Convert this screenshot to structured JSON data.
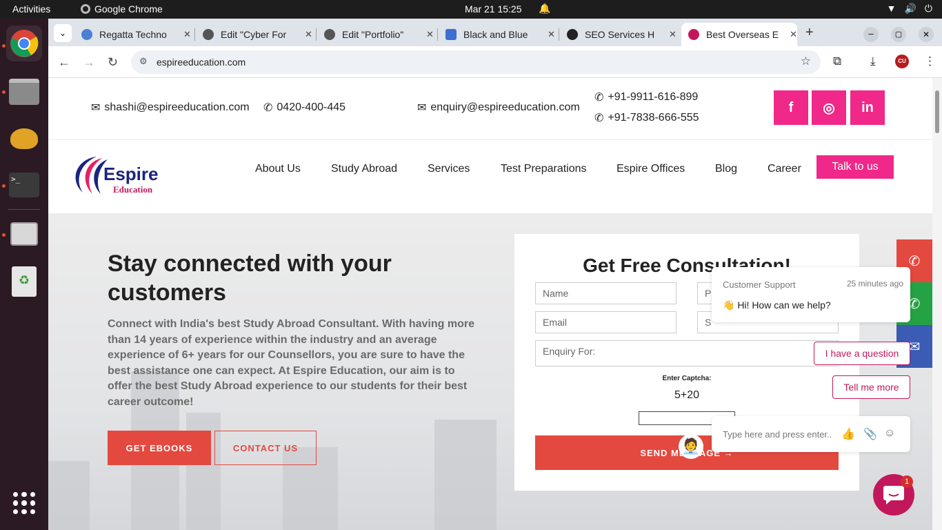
{
  "os": {
    "activities": "Activities",
    "app_name": "Google Chrome",
    "clock": "Mar 21  15:25"
  },
  "browser": {
    "tabs": [
      {
        "title": "Regatta Techno",
        "favicon_color": "#4a7fd4"
      },
      {
        "title": "Edit \"Cyber For",
        "favicon_color": "#555555"
      },
      {
        "title": "Edit \"Portfolio\"",
        "favicon_color": "#555555"
      },
      {
        "title": "Black and Blue",
        "favicon_color": "#3b6fd1"
      },
      {
        "title": "SEO Services H",
        "favicon_color": "#222222"
      },
      {
        "title": "Best Overseas E",
        "favicon_color": "#c2185b"
      }
    ],
    "url": "espireeducation.com",
    "profile_initials": "CU"
  },
  "site": {
    "contacts": {
      "email1": "shashi@espireeducation.com",
      "phone1": "0420-400-445",
      "email2": "enquiry@espireeducation.com",
      "phone2": "+91-9911-616-899",
      "phone3": "+91-7838-666-555"
    },
    "social": [
      "f",
      "◎",
      "in"
    ],
    "logo": {
      "name": "Espire",
      "tag": "Education"
    },
    "nav": [
      "About Us",
      "Study Abroad",
      "Services",
      "Test Preparations",
      "Espire Offices",
      "Blog",
      "Career"
    ],
    "talk_button": "Talk to us",
    "hero": {
      "title": "Stay connected with your customers",
      "body": "Connect with India's best Study Abroad Consultant. With having more than 14 years of experience within the industry and an average experience of 6+ years for our Counsellors, you are sure to have the best assistance one can expect. At Espire Education, our aim is to offer the best Study Abroad experience to our students for their best career outcome!",
      "btn_ebooks": "GET EBOOKS",
      "btn_contact": "CONTACT US"
    },
    "form": {
      "title": "Get Free Consultation!",
      "name_placeholder": "Name",
      "phone_placeholder": "Ph",
      "email_placeholder": "Email",
      "study_placeholder": "S",
      "enquiry_placeholder": "Enquiry For:",
      "captcha_label": "Enter Captcha:",
      "captcha_value": "5+20",
      "send_label": "SEND MESSAGE →"
    }
  },
  "chat": {
    "agent": "Customer Support",
    "time_ago": "25 minutes ago",
    "message": "👋 Hi! How can we help?",
    "quick_replies": [
      "I have a question",
      "Tell me more"
    ],
    "input_placeholder": "Type here and press enter..",
    "unread": "1"
  },
  "colors": {
    "brand_pink": "#f0288a",
    "brand_red": "#e3493f",
    "chat_accent": "#c2185b"
  }
}
